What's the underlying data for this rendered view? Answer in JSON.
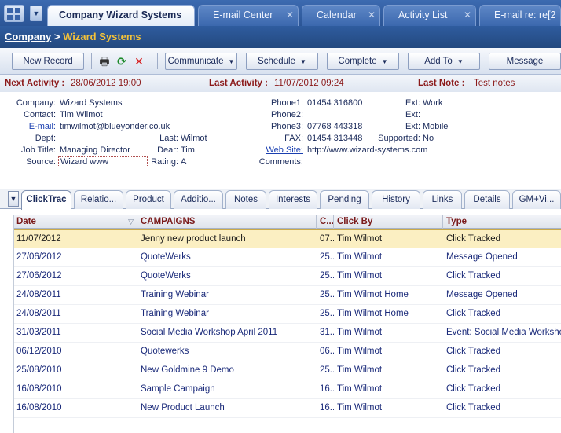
{
  "tabs": [
    {
      "label": "Company Wizard Systems",
      "active": true
    },
    {
      "label": "E-mail Center",
      "active": false
    },
    {
      "label": "Calendar",
      "active": false
    },
    {
      "label": "Activity List",
      "active": false
    },
    {
      "label": "E-mail re: re[2",
      "active": false
    }
  ],
  "breadcrumb": {
    "root": "Company",
    "separator": ">",
    "current": "Wizard Systems"
  },
  "toolbar": {
    "new_record": "New Record",
    "communicate": "Communicate",
    "schedule": "Schedule",
    "complete": "Complete",
    "add_to": "Add To",
    "message": "Message"
  },
  "activity": {
    "next_label": "Next Activity :",
    "next_value": "28/06/2012 19:00",
    "last_label": "Last Activity :",
    "last_value": "11/07/2012 09:24",
    "note_label": "Last Note :",
    "note_value": "Test notes"
  },
  "contact": {
    "company_label": "Company:",
    "company": "Wizard Systems",
    "contact_label": "Contact:",
    "contact": "Tim Wilmot",
    "email_label": "E-mail:",
    "email": "timwilmot@blueyonder.co.uk",
    "dept_label": "Dept:",
    "dept": "",
    "last_label": "Last:",
    "last": "Wilmot",
    "jobtitle_label": "Job Title:",
    "jobtitle": "Managing Director",
    "dear_label": "Dear:",
    "dear": "Tim",
    "source_label": "Source:",
    "source": "Wizard www",
    "rating_label": "Rating:",
    "rating": "A",
    "phone1_label": "Phone1:",
    "phone1": "01454 316800",
    "phone2_label": "Phone2:",
    "phone2": "",
    "phone3_label": "Phone3:",
    "phone3": "07768 443318",
    "fax_label": "FAX:",
    "fax": "01454 313448",
    "website_label": "Web Site:",
    "website": "http://www.wizard-systems.com",
    "comments_label": "Comments:",
    "comments": "",
    "ext1_label": "Ext:",
    "ext1": "Work",
    "ext2_label": "Ext:",
    "ext2": "",
    "ext3_label": "Ext:",
    "ext3": "Mobile",
    "supported_label": "Supported:",
    "supported": "No"
  },
  "subtabs": [
    "ClickTrac",
    "Relatio...",
    "Product",
    "Additio...",
    "Notes",
    "Interests",
    "Pending",
    "History",
    "Links",
    "Details",
    "GM+Vi..."
  ],
  "grid": {
    "headers": [
      "Date",
      "CAMPAIGNS",
      "C...",
      "Click By",
      "Type"
    ],
    "rows": [
      [
        "11/07/2012",
        "Jenny new product launch",
        "07...",
        "Tim Wilmot",
        "Click Tracked"
      ],
      [
        "27/06/2012",
        "QuoteWerks",
        "25...",
        "Tim Wilmot",
        "Message Opened"
      ],
      [
        "27/06/2012",
        "QuoteWerks",
        "25...",
        "Tim Wilmot",
        "Click Tracked"
      ],
      [
        "24/08/2011",
        "Training Webinar",
        "25...",
        "Tim Wilmot Home",
        "Message Opened"
      ],
      [
        "24/08/2011",
        "Training Webinar",
        "25...",
        "Tim Wilmot Home",
        "Click Tracked"
      ],
      [
        "31/03/2011",
        "Social Media Workshop April 2011",
        "31...",
        "Tim Wilmot",
        "Event:  Social Media Workshop"
      ],
      [
        "06/12/2010",
        "Quotewerks",
        "06...",
        "Tim Wilmot",
        "Click Tracked"
      ],
      [
        "25/08/2010",
        "New Goldmine 9 Demo",
        "25...",
        "Tim Wilmot",
        "Click Tracked"
      ],
      [
        "16/08/2010",
        "Sample Campaign",
        "16...",
        "Tim Wilmot",
        "Click Tracked"
      ],
      [
        "16/08/2010",
        "New Product Launch",
        "16...",
        "Tim Wilmot",
        "Click Tracked"
      ]
    ]
  }
}
